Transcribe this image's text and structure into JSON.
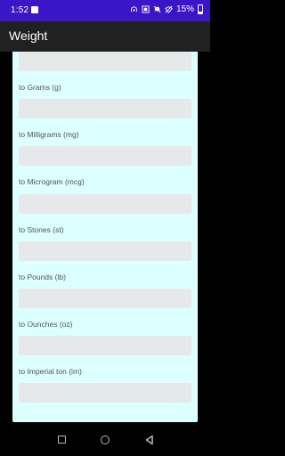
{
  "status_bar": {
    "time": "1:52",
    "battery_text": "15%"
  },
  "app_bar": {
    "title": "Weight"
  },
  "conversions": [
    {
      "label": "",
      "value": ""
    },
    {
      "label": "to Grams (g)",
      "value": ""
    },
    {
      "label": "to Milligrams (mg)",
      "value": ""
    },
    {
      "label": "to Microgram (mcg)",
      "value": ""
    },
    {
      "label": "to Stones (st)",
      "value": ""
    },
    {
      "label": "to Pounds (lb)",
      "value": ""
    },
    {
      "label": "to Ounches (oz)",
      "value": ""
    },
    {
      "label": "to Imperial ton (im)",
      "value": ""
    }
  ],
  "colors": {
    "status_bar": "#3a16c9",
    "app_bar": "#212121",
    "card": "#dcffff",
    "field": "#e6e8ea"
  },
  "icons": {
    "status": [
      "image-icon",
      "hotspot-icon",
      "data-saver-icon",
      "mute-icon",
      "wifi-off-icon",
      "battery-icon"
    ],
    "nav": [
      "recents-icon",
      "home-icon",
      "back-icon"
    ]
  }
}
